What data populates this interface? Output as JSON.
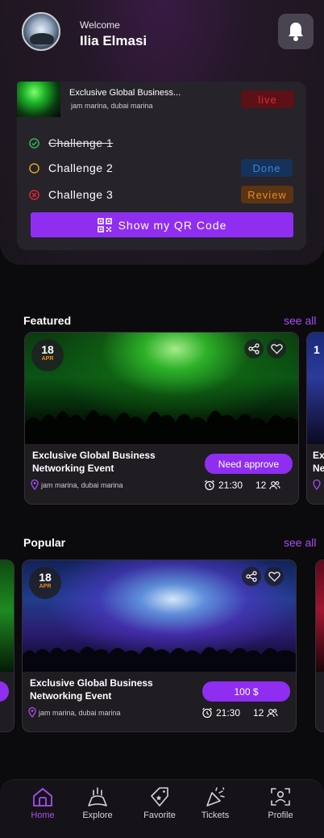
{
  "header": {
    "welcome": "Welcome",
    "user_name": "Ilia Elmasi",
    "avatar_icon": "avatar",
    "bell_icon": "bell-icon"
  },
  "challenge_card": {
    "event_title": "Exclusive Global Business...",
    "event_location": "jam marina, dubai marina",
    "status": "live",
    "challenges": [
      {
        "label": "Challenge 1",
        "state": "completed",
        "badge": ""
      },
      {
        "label": "Challenge 2",
        "state": "pending",
        "badge": "Done"
      },
      {
        "label": "Challenge 3",
        "state": "failed",
        "badge": "Review"
      }
    ],
    "qr_button": "Show my QR Code"
  },
  "featured": {
    "title": "Featured",
    "see_all": "see all",
    "card": {
      "day": "18",
      "month": "APR",
      "title": "Exclusive Global Business Networking Event",
      "location": "jam marina, dubai marina",
      "action": "Need approve",
      "time": "21:30",
      "attendees": "12"
    },
    "peek_day": "1",
    "peek_text": "Ex Ne"
  },
  "popular": {
    "title": "Popular",
    "see_all": "see all",
    "card": {
      "day": "18",
      "month": "APR",
      "title": "Exclusive Global Business Networking Event",
      "location": "jam marina, dubai marina",
      "action": "100 $",
      "time": "21:30",
      "attendees": "12"
    }
  },
  "nav": [
    {
      "label": "Home",
      "icon": "home-icon",
      "active": true
    },
    {
      "label": "Explore",
      "icon": "explore-icon",
      "active": false
    },
    {
      "label": "Favorite",
      "icon": "favorite-tag-icon",
      "active": false
    },
    {
      "label": "Tickets",
      "icon": "tickets-party-icon",
      "active": false
    },
    {
      "label": "Profile",
      "icon": "profile-icon",
      "active": false
    }
  ],
  "colors": {
    "accent": "#8f2ef0",
    "accent_text": "#a94ef0",
    "live": "#e02a35",
    "done": "#3a84d8",
    "review": "#e88a25",
    "success": "#2fbf5a",
    "pending": "#e8b020"
  }
}
